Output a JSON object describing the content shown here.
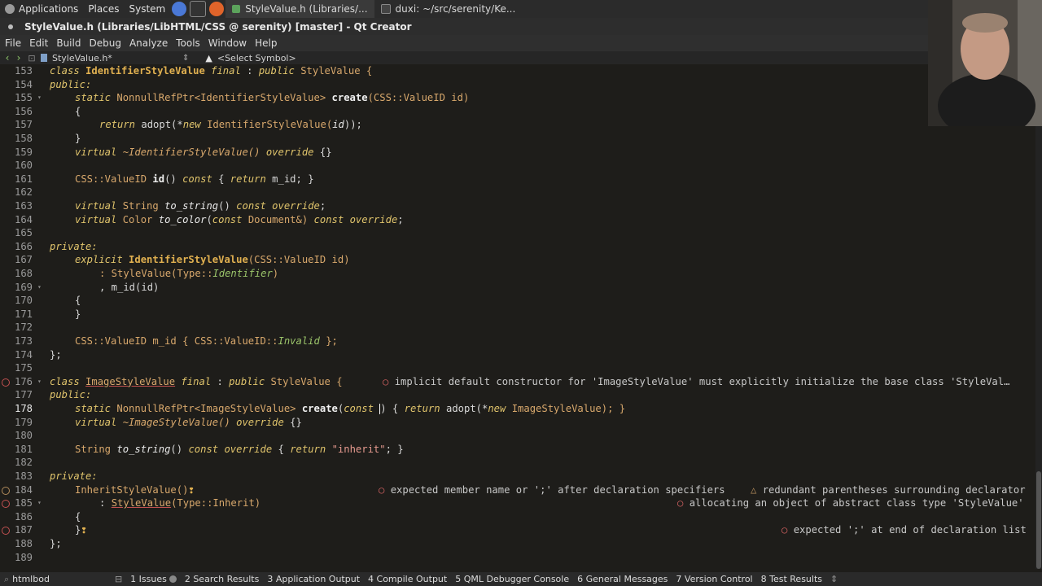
{
  "panel": {
    "applications": "Applications",
    "places": "Places",
    "system": "System",
    "tasks": [
      {
        "label": "StyleValue.h (Libraries/..."
      },
      {
        "label": "duxi: ~/src/serenity/Ke..."
      }
    ]
  },
  "window_title": "StyleValue.h (Libraries/LibHTML/CSS @ serenity) [master] - Qt Creator",
  "menu": [
    "File",
    "Edit",
    "Build",
    "Debug",
    "Analyze",
    "Tools",
    "Window",
    "Help"
  ],
  "editor_toolbar": {
    "file_name": "StyleValue.h*",
    "symbol": "<Select Symbol>"
  },
  "code_lines": [
    {
      "n": "153"
    },
    {
      "n": "154"
    },
    {
      "n": "155"
    },
    {
      "n": "156"
    },
    {
      "n": "157"
    },
    {
      "n": "158"
    },
    {
      "n": "159"
    },
    {
      "n": "160"
    },
    {
      "n": "161"
    },
    {
      "n": "162"
    },
    {
      "n": "163"
    },
    {
      "n": "164"
    },
    {
      "n": "165"
    },
    {
      "n": "166"
    },
    {
      "n": "167"
    },
    {
      "n": "168"
    },
    {
      "n": "169"
    },
    {
      "n": "170"
    },
    {
      "n": "171"
    },
    {
      "n": "172"
    },
    {
      "n": "173"
    },
    {
      "n": "174"
    },
    {
      "n": "175"
    },
    {
      "n": "176"
    },
    {
      "n": "177"
    },
    {
      "n": "178"
    },
    {
      "n": "179"
    },
    {
      "n": "180"
    },
    {
      "n": "181"
    },
    {
      "n": "182"
    },
    {
      "n": "183"
    },
    {
      "n": "184"
    },
    {
      "n": "185"
    },
    {
      "n": "186"
    },
    {
      "n": "187"
    },
    {
      "n": "188"
    },
    {
      "n": "189"
    }
  ],
  "code": {
    "l153_a": "class ",
    "l153_b": "IdentifierStyleValue",
    "l153_c": " final",
    "l153_d": " : ",
    "l153_e": "public",
    "l153_f": " StyleValue {",
    "l154": "public:",
    "l155_a": "static",
    "l155_b": " NonnullRefPtr<IdentifierStyleValue> ",
    "l155_c": "create",
    "l155_d": "(CSS::ValueID id)",
    "l156": "{",
    "l157_a": "return",
    "l157_b": " adopt(*",
    "l157_c": "new",
    "l157_d": " IdentifierStyleValue(",
    "l157_e": "id",
    "l157_f": "));",
    "l158": "}",
    "l159_a": "virtual",
    "l159_b": " ~IdentifierStyleValue() ",
    "l159_c": "override",
    "l159_d": " {}",
    "l161_a": "CSS::ValueID ",
    "l161_b": "id",
    "l161_c": "() ",
    "l161_d": "const",
    "l161_e": " { ",
    "l161_f": "return",
    "l161_g": " m_id; }",
    "l163_a": "virtual",
    "l163_b": " String ",
    "l163_c": "to_string",
    "l163_d": "() ",
    "l163_e": "const",
    "l163_f": " ",
    "l163_g": "override",
    "l163_h": ";",
    "l164_a": "virtual",
    "l164_b": " Color ",
    "l164_c": "to_color",
    "l164_d": "(",
    "l164_e": "const",
    "l164_f": " Document&) ",
    "l164_g": "const",
    "l164_h": " ",
    "l164_i": "override",
    "l164_j": ";",
    "l166": "private:",
    "l167_a": "explicit",
    "l167_b": " ",
    "l167_c": "IdentifierStyleValue",
    "l167_d": "(CSS::ValueID id)",
    "l168_a": ": StyleValue(Type::",
    "l168_b": "Identifier",
    "l168_c": ")",
    "l169": ", m_id(id)",
    "l170": "{",
    "l171": "}",
    "l173_a": "CSS::ValueID m_id { CSS::ValueID::",
    "l173_b": "Invalid",
    "l173_c": " };",
    "l174": "};",
    "l176_a": "class ",
    "l176_b": "ImageStyleValue",
    "l176_c": " final",
    "l176_d": " : ",
    "l176_e": "public",
    "l176_f": " StyleValue {",
    "l177": "public:",
    "l178_a": "static",
    "l178_b": " NonnullRefPtr<ImageStyleValue> ",
    "l178_c": "create",
    "l178_d": "(",
    "l178_e": "const",
    "l178_f": " ",
    "l178_g": ") { ",
    "l178_h": "return",
    "l178_i": " adopt(*",
    "l178_j": "new",
    "l178_k": " ImageStyleValue); }",
    "l179_a": "virtual",
    "l179_b": " ~ImageStyleValue() ",
    "l179_c": "override",
    "l179_d": " {}",
    "l181_a": "String ",
    "l181_b": "to_string",
    "l181_c": "() ",
    "l181_d": "const",
    "l181_e": " ",
    "l181_f": "override",
    "l181_g": " { ",
    "l181_h": "return",
    "l181_i": " ",
    "l181_j": "\"inherit\"",
    "l181_k": "; }",
    "l183": "private:",
    "l184": "InheritStyleValue()",
    "l185_a": ": ",
    "l185_b": "StyleValue",
    "l185_c": "(Type::Inherit)",
    "l186": "{",
    "l187": "}",
    "l188": "};"
  },
  "diagnostics": {
    "d176": "implicit default constructor for 'ImageStyleValue' must explicitly initialize the base class 'StyleVal…",
    "d184a": "expected member name or ';' after declaration specifiers",
    "d184b": "redundant parentheses surrounding declarator",
    "d185": "allocating an object of abstract class type 'StyleValue'",
    "d187": "expected ';' at end of declaration list"
  },
  "statusbar": {
    "locator": "htmlbod",
    "items": [
      {
        "label": "1 Issues"
      },
      {
        "label": "2 Search Results"
      },
      {
        "label": "3 Application Output"
      },
      {
        "label": "4 Compile Output"
      },
      {
        "label": "5 QML Debugger Console"
      },
      {
        "label": "6 General Messages"
      },
      {
        "label": "7 Version Control"
      },
      {
        "label": "8 Test Results"
      }
    ]
  }
}
